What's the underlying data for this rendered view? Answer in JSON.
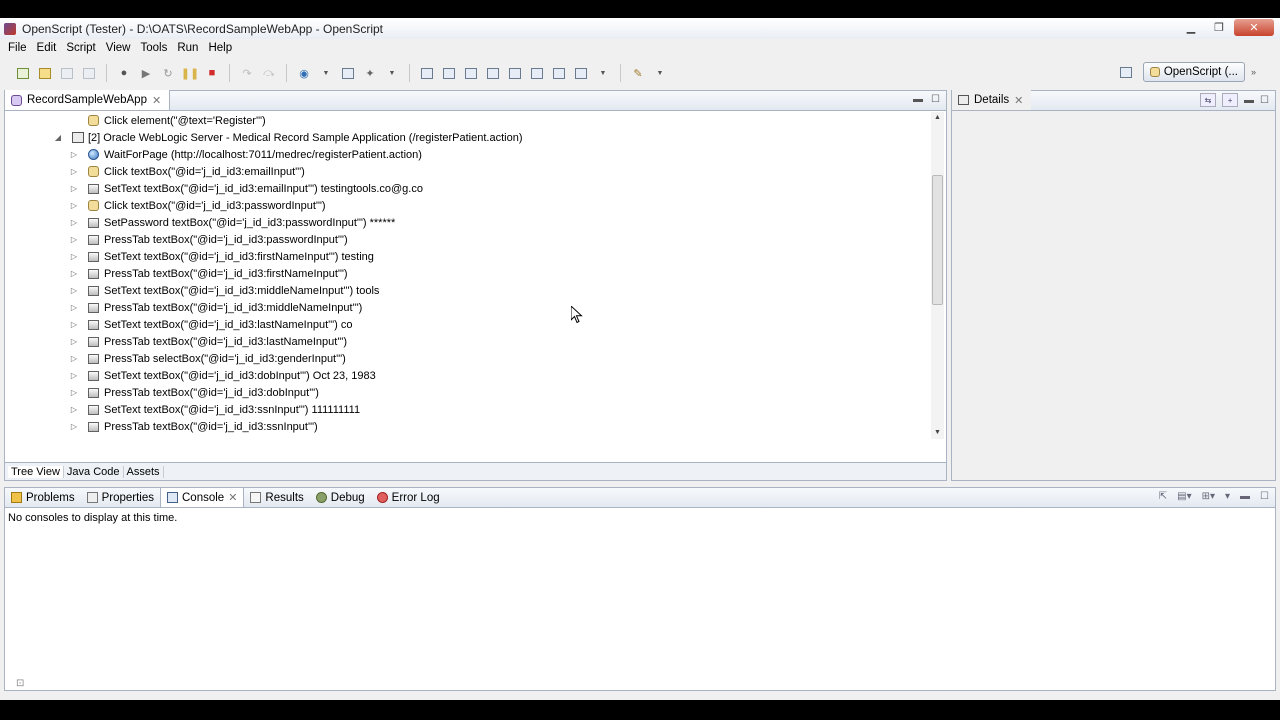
{
  "window": {
    "title": "OpenScript (Tester) - D:\\OATS\\RecordSampleWebApp - OpenScript"
  },
  "menu": [
    "File",
    "Edit",
    "Script",
    "View",
    "Tools",
    "Run",
    "Help"
  ],
  "perspective": {
    "label": "OpenScript (..."
  },
  "editor": {
    "tab_label": "RecordSampleWebApp",
    "rows": [
      {
        "text": "Click element(\"@text='Register'\")",
        "icon": "hand-icon",
        "indent": 2,
        "twisty": ""
      },
      {
        "text": "[2] Oracle WebLogic Server - Medical Record Sample Application (/registerPatient.action)",
        "icon": "page-step-icon",
        "indent": 1,
        "twisty": "◢"
      },
      {
        "text": "WaitForPage (http://localhost:7011/medrec/registerPatient.action)",
        "icon": "globe-icon",
        "indent": 2,
        "twisty": "▷"
      },
      {
        "text": "Click textBox(\"@id='j_id_id3:emailInput'\")",
        "icon": "hand-icon",
        "indent": 2,
        "twisty": "▷"
      },
      {
        "text": "SetText textBox(\"@id='j_id_id3:emailInput'\") testingtools.co@g.co",
        "icon": "textbox-icon",
        "indent": 2,
        "twisty": "▷"
      },
      {
        "text": "Click textBox(\"@id='j_id_id3:passwordInput'\")",
        "icon": "hand-icon",
        "indent": 2,
        "twisty": "▷"
      },
      {
        "text": "SetPassword textBox(\"@id='j_id_id3:passwordInput'\") ******",
        "icon": "textbox-icon",
        "indent": 2,
        "twisty": "▷"
      },
      {
        "text": "PressTab textBox(\"@id='j_id_id3:passwordInput'\")",
        "icon": "textbox-icon",
        "indent": 2,
        "twisty": "▷"
      },
      {
        "text": "SetText textBox(\"@id='j_id_id3:firstNameInput'\") testing",
        "icon": "textbox-icon",
        "indent": 2,
        "twisty": "▷"
      },
      {
        "text": "PressTab textBox(\"@id='j_id_id3:firstNameInput'\")",
        "icon": "textbox-icon",
        "indent": 2,
        "twisty": "▷"
      },
      {
        "text": "SetText textBox(\"@id='j_id_id3:middleNameInput'\") tools",
        "icon": "textbox-icon",
        "indent": 2,
        "twisty": "▷"
      },
      {
        "text": "PressTab textBox(\"@id='j_id_id3:middleNameInput'\")",
        "icon": "textbox-icon",
        "indent": 2,
        "twisty": "▷"
      },
      {
        "text": "SetText textBox(\"@id='j_id_id3:lastNameInput'\") co",
        "icon": "textbox-icon",
        "indent": 2,
        "twisty": "▷"
      },
      {
        "text": "PressTab textBox(\"@id='j_id_id3:lastNameInput'\")",
        "icon": "textbox-icon",
        "indent": 2,
        "twisty": "▷"
      },
      {
        "text": "PressTab selectBox(\"@id='j_id_id3:genderInput'\")",
        "icon": "textbox-icon",
        "indent": 2,
        "twisty": "▷"
      },
      {
        "text": "SetText textBox(\"@id='j_id_id3:dobInput'\") Oct 23, 1983",
        "icon": "textbox-icon",
        "indent": 2,
        "twisty": "▷"
      },
      {
        "text": "PressTab textBox(\"@id='j_id_id3:dobInput'\")",
        "icon": "textbox-icon",
        "indent": 2,
        "twisty": "▷"
      },
      {
        "text": "SetText textBox(\"@id='j_id_id3:ssnInput'\") 111111111",
        "icon": "textbox-icon",
        "indent": 2,
        "twisty": "▷"
      },
      {
        "text": "PressTab textBox(\"@id='j_id_id3:ssnInput'\")",
        "icon": "textbox-icon",
        "indent": 2,
        "twisty": "▷"
      }
    ],
    "bottom_tabs": [
      "Tree View",
      "Java Code",
      "Assets"
    ]
  },
  "details": {
    "tab_label": "Details"
  },
  "console": {
    "tabs": [
      "Problems",
      "Properties",
      "Console",
      "Results",
      "Debug",
      "Error Log"
    ],
    "message": "No consoles to display at this time."
  }
}
